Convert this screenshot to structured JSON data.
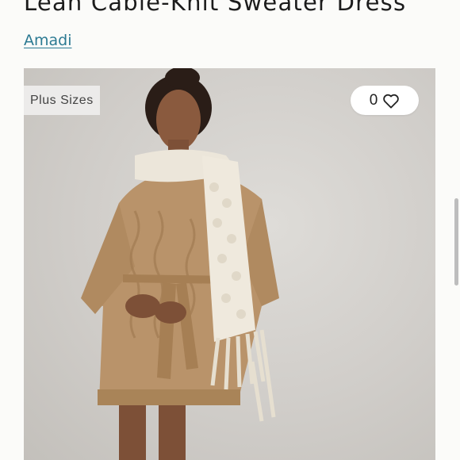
{
  "product": {
    "title": "Leah Cable-Knit Sweater Dress",
    "brand": "Amadi"
  },
  "image": {
    "badge": "Plus Sizes",
    "like_count": "0",
    "like_icon": "heart-outline-icon"
  }
}
